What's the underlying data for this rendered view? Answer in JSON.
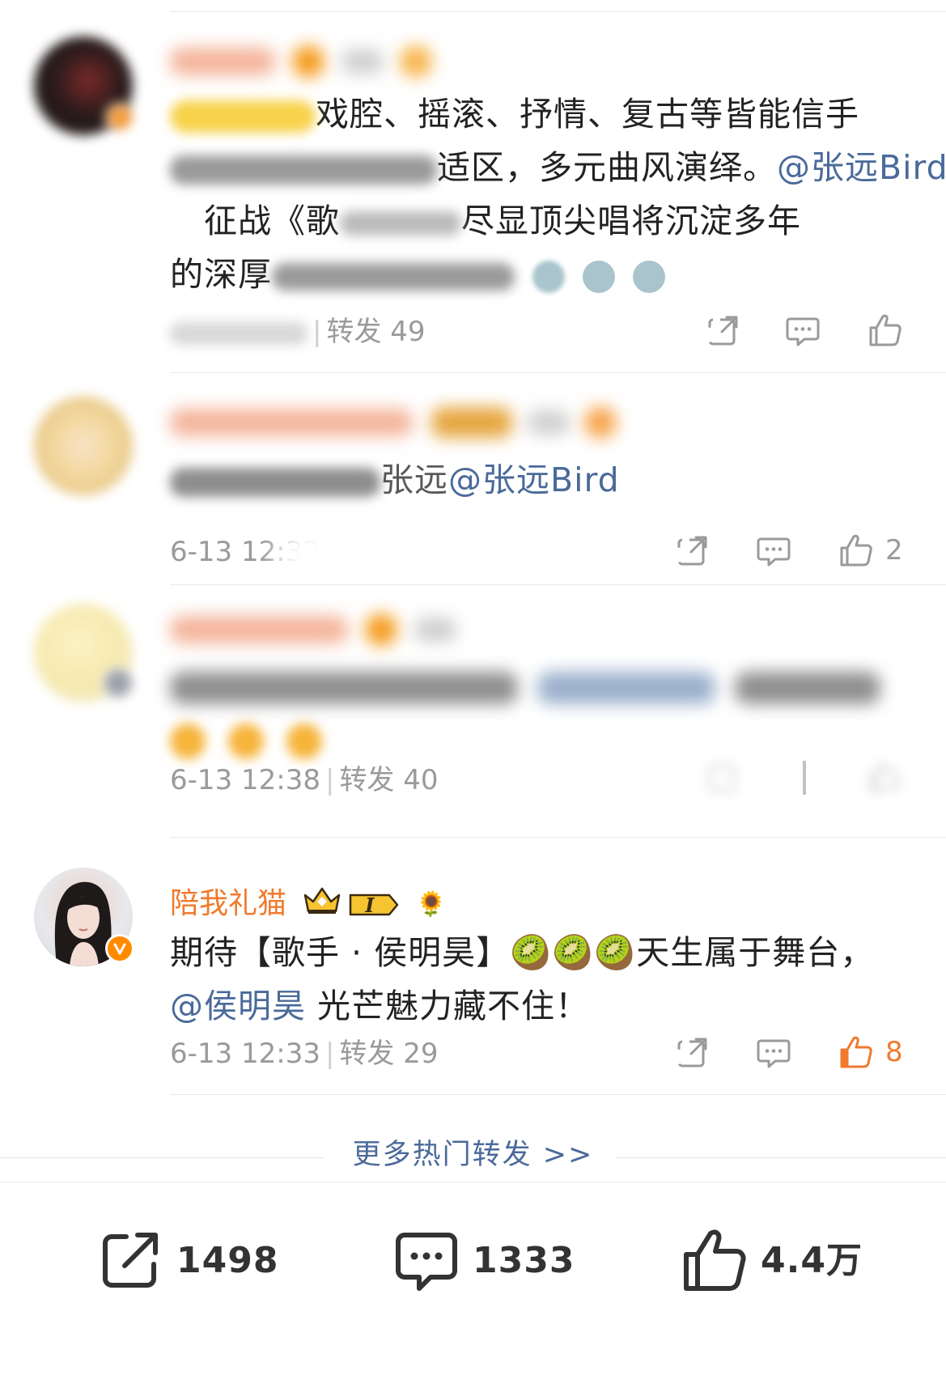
{
  "posts": [
    {
      "username": "",
      "content_lead": "",
      "content_main": "戏腔、摇滚、抒情、复古等皆能信手",
      "content_line2_text": "适区，多元曲风演绎。",
      "content_mention": "@张远Bird",
      "content_line3": "征战《歌",
      "content_line3b": "尽显顶尖唱将沉淀多年",
      "content_line4": "的深厚",
      "time": "",
      "repost_label": "转发",
      "repost_count": "49",
      "like_count": ""
    },
    {
      "username": "",
      "content_text": "张远",
      "content_mention": "@张远Bird",
      "time": "6-13 12:32",
      "like_count": "2"
    },
    {
      "username": "",
      "time": "6-13 12:38",
      "repost_label": "转发",
      "repost_count": "40"
    },
    {
      "username": "陪我礼猫",
      "content_line1": "期待【歌手 · 侯明昊】🥝🥝🥝天生属于舞台，",
      "content_mention": "@侯明昊",
      "content_line2": "光芒魅力藏不住！",
      "time": "6-13 12:33",
      "repost_label": "转发",
      "repost_count": "29",
      "like_count": "8",
      "badge_emoji": "🌻",
      "badge_level": "I"
    }
  ],
  "more_link": "更多热门转发 >>",
  "bottom_bar": {
    "reposts": "1498",
    "comments": "1333",
    "likes": "4.4万"
  },
  "icons": {
    "repost": "share-arrow-icon",
    "comment": "speech-bubble-icon",
    "like": "thumbs-up-icon"
  },
  "colors": {
    "accent_orange": "#f07a2c",
    "link_blue": "#4a6a9a",
    "meta_gray": "#9a9a9a"
  }
}
